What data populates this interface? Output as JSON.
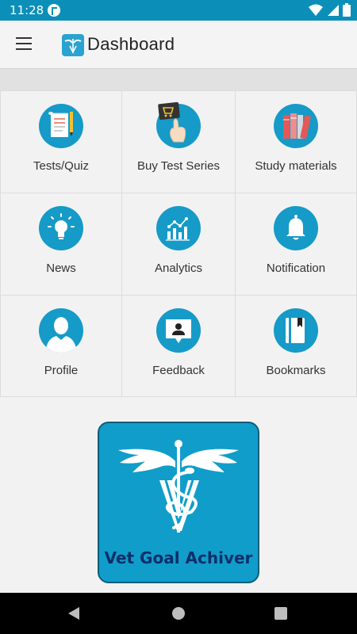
{
  "status_bar": {
    "time": "11:28",
    "icons": [
      "app-notification-icon",
      "wifi-icon",
      "signal-icon",
      "battery-icon"
    ]
  },
  "app_bar": {
    "title": "Dashboard",
    "menu_icon": "hamburger-menu-icon",
    "logo": "vet-goal-achiver-logo"
  },
  "dashboard": {
    "tiles": [
      {
        "label": "Tests/Quiz",
        "icon": "tests-quiz-icon"
      },
      {
        "label": "Buy Test Series",
        "icon": "buy-test-series-icon"
      },
      {
        "label": "Study materials",
        "icon": "study-materials-icon"
      },
      {
        "label": "News",
        "icon": "news-icon"
      },
      {
        "label": "Analytics",
        "icon": "analytics-icon"
      },
      {
        "label": "Notification",
        "icon": "notification-icon"
      },
      {
        "label": "Profile",
        "icon": "profile-icon"
      },
      {
        "label": "Feedback",
        "icon": "feedback-icon"
      },
      {
        "label": "Bookmarks",
        "icon": "bookmarks-icon"
      }
    ]
  },
  "brand": {
    "name": "Vet Goal Achiver",
    "emblem": "veterinary-caduceus-emblem"
  },
  "nav_bar": {
    "buttons": [
      "back-icon",
      "home-icon",
      "recents-icon"
    ]
  },
  "colors": {
    "status_bar": "#0b8fb9",
    "accent": "#169ac8",
    "brand_card": "#119dca",
    "brand_text": "#0b2f6a"
  }
}
